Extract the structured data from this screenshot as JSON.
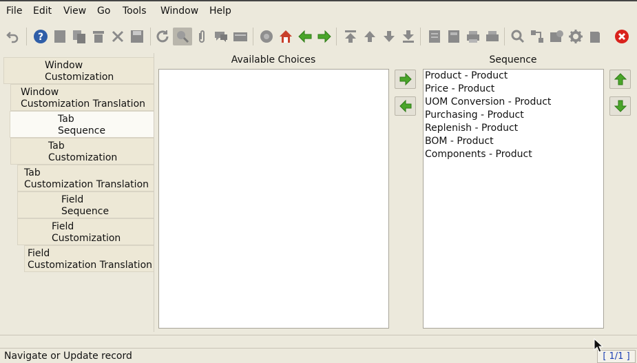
{
  "menu": [
    {
      "label": "File",
      "name": "menu-file"
    },
    {
      "label": "Edit",
      "name": "menu-edit"
    },
    {
      "label": "View",
      "name": "menu-view"
    },
    {
      "label": "Go",
      "name": "menu-go"
    },
    {
      "label": "Tools",
      "name": "menu-tools"
    },
    {
      "label": "Window",
      "name": "menu-window"
    },
    {
      "label": "Help",
      "name": "menu-help"
    }
  ],
  "toolbar_icons": [
    "undo-icon",
    "help-icon",
    "new-record-icon",
    "copy-record-icon",
    "delete-icon",
    "delete-selection-icon",
    "save-icon",
    "refresh-icon",
    "find-icon",
    "attachment-icon",
    "chat-icon",
    "history-icon",
    "menu-icon",
    "home-icon",
    "back-icon",
    "forward-icon",
    "first-record-icon",
    "previous-record-icon",
    "next-record-icon",
    "last-record-icon",
    "report-icon",
    "archive-icon",
    "print-preview-icon",
    "print-icon",
    "zoom-across-icon",
    "workflow-icon",
    "request-icon",
    "process-icon",
    "product-info-icon",
    "exit-icon"
  ],
  "tabs": [
    {
      "line1": "Window",
      "line2": "Customization"
    },
    {
      "line1": "Window",
      "line2": "Customization Translation"
    },
    {
      "line1": "Tab",
      "line2": "Sequence"
    },
    {
      "line1": "Tab",
      "line2": "Customization"
    },
    {
      "line1": "Tab",
      "line2": "Customization Translation"
    },
    {
      "line1": "Field",
      "line2": "Sequence"
    },
    {
      "line1": "Field",
      "line2": "Customization"
    },
    {
      "line1": "Field",
      "line2": "Customization Translation"
    }
  ],
  "available": {
    "title": "Available Choices",
    "items": []
  },
  "sequence": {
    "title": "Sequence",
    "items": [
      "Product - Product",
      "Price - Product",
      "UOM Conversion - Product",
      "Purchasing - Product",
      "Replenish - Product",
      "BOM - Product",
      "Components - Product"
    ]
  },
  "status": {
    "text": "Navigate or Update record",
    "record_count": "[ 1/1 ]"
  },
  "colors": {
    "arrow_green": "#4aa52a",
    "exit_red": "#d9221c",
    "home_red": "#c8402a",
    "record_blue": "#1a3fb5"
  }
}
